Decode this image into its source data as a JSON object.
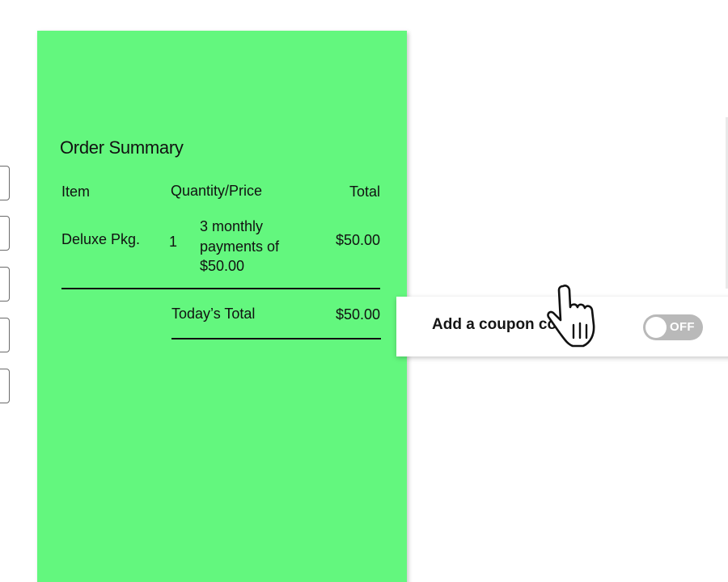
{
  "order_summary": {
    "title": "Order Summary",
    "columns": {
      "item": "Item",
      "quantity_price": "Quantity/Price",
      "total": "Total"
    },
    "rows": [
      {
        "item": "Deluxe Pkg.",
        "quantity": "1",
        "description": "3 monthly payments of $50.00",
        "total": "$50.00"
      }
    ],
    "today_label": "Today’s Total",
    "today_total": "$50.00"
  },
  "coupon": {
    "label": "Add a coupon code",
    "toggle_label": "OFF",
    "toggle_on": false
  },
  "colors": {
    "summary_panel": "#63f77e",
    "toggle_off": "#b9b9b9"
  },
  "icons": {
    "cursor": "hand-pointer-icon"
  }
}
